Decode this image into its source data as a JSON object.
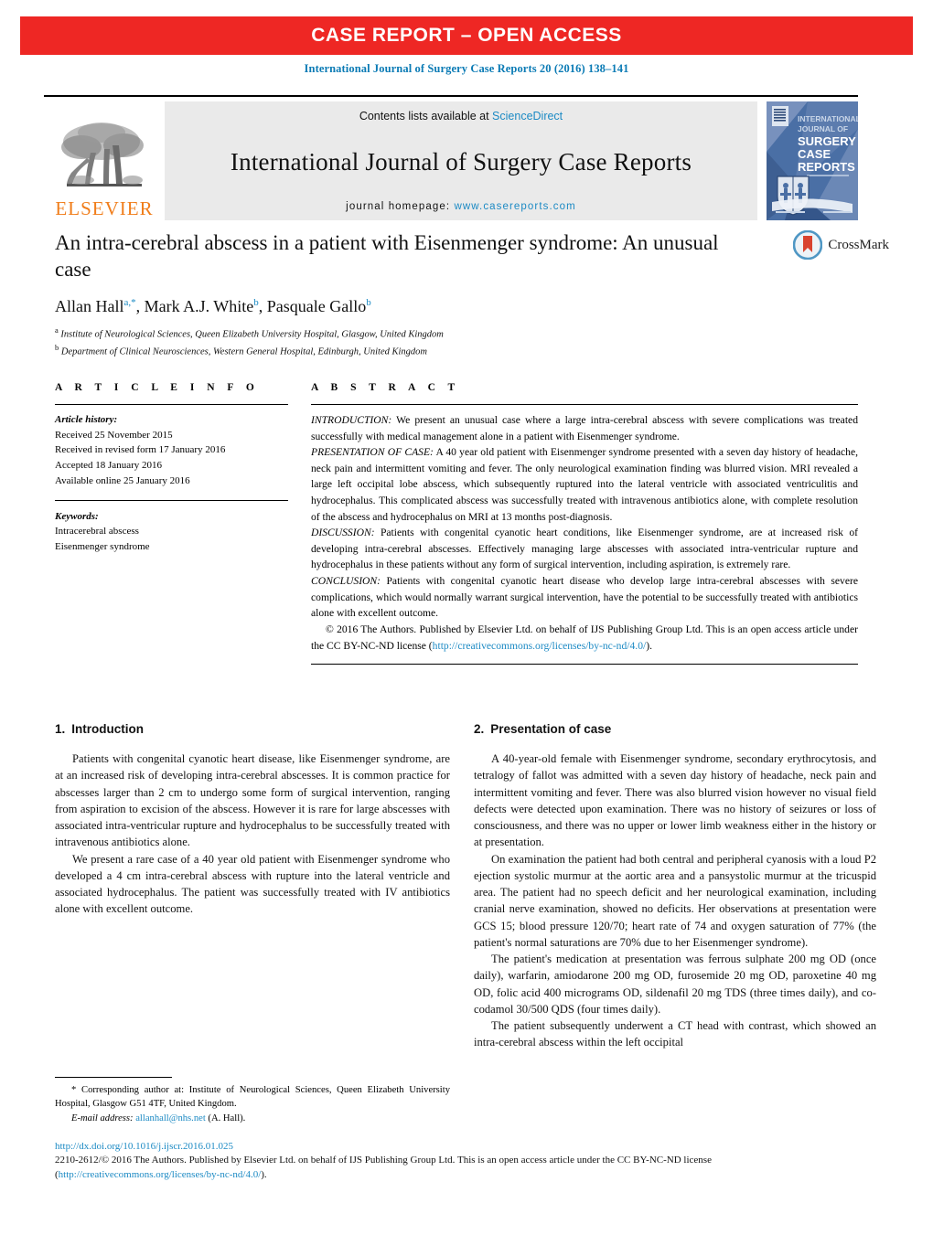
{
  "banner": {
    "label": "CASE REPORT – OPEN ACCESS",
    "color": "#ee2724"
  },
  "journal_reference": "International Journal of Surgery Case Reports 20 (2016) 138–141",
  "masthead": {
    "publisher_name": "ELSEVIER",
    "contents_prefix": "Contents lists available at ",
    "contents_link": "ScienceDirect",
    "journal_title": "International Journal of Surgery Case Reports",
    "homepage_prefix": "journal homepage: ",
    "homepage_url": "www.casereports.com",
    "cover_title_lines": [
      "INTERNATIONAL",
      "JOURNAL OF",
      "SURGERY",
      "CASE",
      "REPORTS"
    ]
  },
  "article": {
    "title": "An intra-cerebral abscess in a patient with Eisenmenger syndrome: An unusual case",
    "authors_html": "Allan Hall<sup>a,*</sup>, Mark A.J. White<sup>b</sup>, Pasquale Gallo<sup>b</sup>",
    "authors_plain": "Allan Hall a,*, Mark A.J. White b, Pasquale Gallo b",
    "affiliation_a": "Institute of Neurological Sciences, Queen Elizabeth University Hospital, Glasgow, United Kingdom",
    "affiliation_b": "Department of Clinical Neurosciences, Western General Hospital, Edinburgh, United Kingdom",
    "crossmark_label": "CrossMark"
  },
  "article_info": {
    "heading": "A R T I C L E   I N F O",
    "history_label": "Article history:",
    "history": [
      "Received 25 November 2015",
      "Received in revised form 17 January 2016",
      "Accepted 18 January 2016",
      "Available online 25 January 2016"
    ],
    "keywords_label": "Keywords:",
    "keywords": [
      "Intracerebral abscess",
      "Eisenmenger syndrome"
    ]
  },
  "abstract": {
    "heading": "A B S T R A C T",
    "introduction_label": "INTRODUCTION:",
    "introduction": " We present an unusual case where a large intra-cerebral abscess with severe complications was treated successfully with medical management alone in a patient with Eisenmenger syndrome.",
    "presentation_label": "PRESENTATION OF CASE:",
    "presentation": " A 40 year old patient with Eisenmenger syndrome presented with a seven day history of headache, neck pain and intermittent vomiting and fever. The only neurological examination finding was blurred vision. MRI revealed a large left occipital lobe abscess, which subsequently ruptured into the lateral ventricle with associated ventriculitis and hydrocephalus. This complicated abscess was successfully treated with intravenous antibiotics alone, with complete resolution of the abscess and hydrocephalus on MRI at 13 months post-diagnosis.",
    "discussion_label": "DISCUSSION:",
    "discussion": " Patients with congenital cyanotic heart conditions, like Eisenmenger syndrome, are at increased risk of developing intra-cerebral abscesses. Effectively managing large abscesses with associated intra-ventricular rupture and hydrocephalus in these patients without any form of surgical intervention, including aspiration, is extremely rare.",
    "conclusion_label": "CONCLUSION:",
    "conclusion": " Patients with congenital cyanotic heart disease who develop large intra-cerebral abscesses with severe complications, which would normally warrant surgical intervention, have the potential to be successfully treated with antibiotics alone with excellent outcome.",
    "copyright_text": "© 2016 The Authors. Published by Elsevier Ltd. on behalf of IJS Publishing Group Ltd. This is an open access article under the CC BY-NC-ND license (",
    "copyright_link": "http://creativecommons.org/licenses/by-nc-nd/4.0/",
    "copyright_tail": ")."
  },
  "sections": {
    "introduction": {
      "number": "1.",
      "title": "Introduction",
      "paragraphs": [
        "Patients with congenital cyanotic heart disease, like Eisenmenger syndrome, are at an increased risk of developing intra-cerebral abscesses. It is common practice for abscesses larger than 2 cm to undergo some form of surgical intervention, ranging from aspiration to excision of the abscess. However it is rare for large abscesses with associated intra-ventricular rupture and hydrocephalus to be successfully treated with intravenous antibiotics alone.",
        "We present a rare case of a 40 year old patient with Eisenmenger syndrome who developed a 4 cm intra-cerebral abscess with rupture into the lateral ventricle and associated hydrocephalus. The patient was successfully treated with IV antibiotics alone with excellent outcome."
      ]
    },
    "presentation": {
      "number": "2.",
      "title": "Presentation of case",
      "paragraphs": [
        "A 40-year-old female with Eisenmenger syndrome, secondary erythrocytosis, and tetralogy of fallot was admitted with a seven day history of headache, neck pain and intermittent vomiting and fever. There was also blurred vision however no visual field defects were detected upon examination. There was no history of seizures or loss of consciousness, and there was no upper or lower limb weakness either in the history or at presentation.",
        "On examination the patient had both central and peripheral cyanosis with a loud P2 ejection systolic murmur at the aortic area and a pansystolic murmur at the tricuspid area. The patient had no speech deficit and her neurological examination, including cranial nerve examination, showed no deficits. Her observations at presentation were GCS 15; blood pressure 120/70; heart rate of 74 and oxygen saturation of 77% (the patient's normal saturations are 70% due to her Eisenmenger syndrome).",
        "The patient's medication at presentation was ferrous sulphate 200 mg OD (once daily), warfarin, amiodarone 200 mg OD, furosemide 20 mg OD, paroxetine 40 mg OD, folic acid 400 micrograms OD, sildenafil 20 mg TDS (three times daily), and co-codamol 30/500 QDS (four times daily).",
        "The patient subsequently underwent a CT head with contrast, which showed an intra-cerebral abscess within the left occipital"
      ]
    }
  },
  "footnote": {
    "corresponding": "* Corresponding author at: Institute of Neurological Sciences, Queen Elizabeth University Hospital, Glasgow G51 4TF, United Kingdom.",
    "email_label": "E-mail address:",
    "email": "allanhall@nhs.net",
    "email_suffix": " (A. Hall)."
  },
  "page_footer": {
    "doi": "http://dx.doi.org/10.1016/j.ijscr.2016.01.025",
    "issn_text": "2210-2612/© 2016 The Authors. Published by Elsevier Ltd. on behalf of IJS Publishing Group Ltd. This is an open access article under the CC BY-NC-ND license (",
    "license_link_1": "http://",
    "license_link_2": "creativecommons.org/licenses/by-nc-nd/4.0/",
    "issn_tail": ")."
  },
  "colors": {
    "banner_red": "#ee2724",
    "link_blue": "#1c8ac4",
    "elsevier_orange": "#f07d1a",
    "masthead_gray": "#eaeaea"
  }
}
